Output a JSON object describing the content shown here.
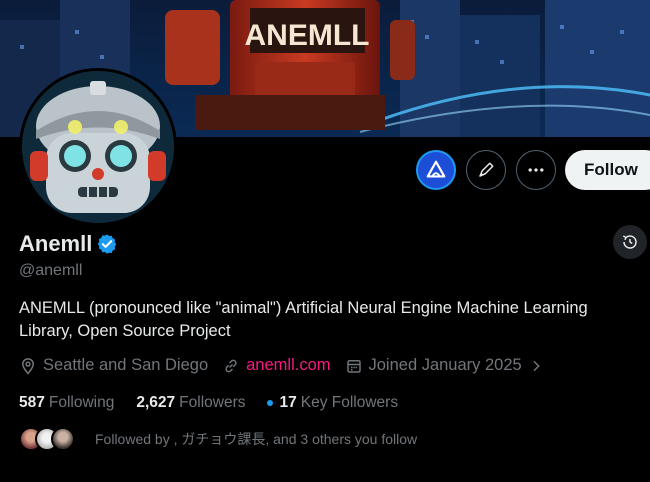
{
  "banner": {
    "text": "ANEMLL"
  },
  "profile": {
    "display_name": "Anemll",
    "handle": "@anemll",
    "bio": "ANEMLL (pronounced like \"animal\") Artificial Neural Engine Machine Learning Library, Open Source Project",
    "location": "Seattle and San Diego",
    "website": "anemll.com",
    "joined": "Joined January 2025"
  },
  "actions": {
    "follow_label": "Follow"
  },
  "stats": {
    "following_count": "587",
    "following_label": "Following",
    "followers_count": "2,627",
    "followers_label": "Followers",
    "key_followers_count": "17",
    "key_followers_label": "Key Followers"
  },
  "followed_by": {
    "text": "Followed by   , ガチョウ課長, and 3 others you follow"
  },
  "colors": {
    "accent": "#1d9bf0",
    "link": "#f91880",
    "muted": "#71767b",
    "text": "#e7e9ea"
  },
  "icons": [
    "location-icon",
    "link-icon",
    "calendar-icon",
    "chevron-right-icon",
    "verified-icon",
    "grok-icon",
    "pen-icon",
    "more-icon",
    "history-icon"
  ]
}
